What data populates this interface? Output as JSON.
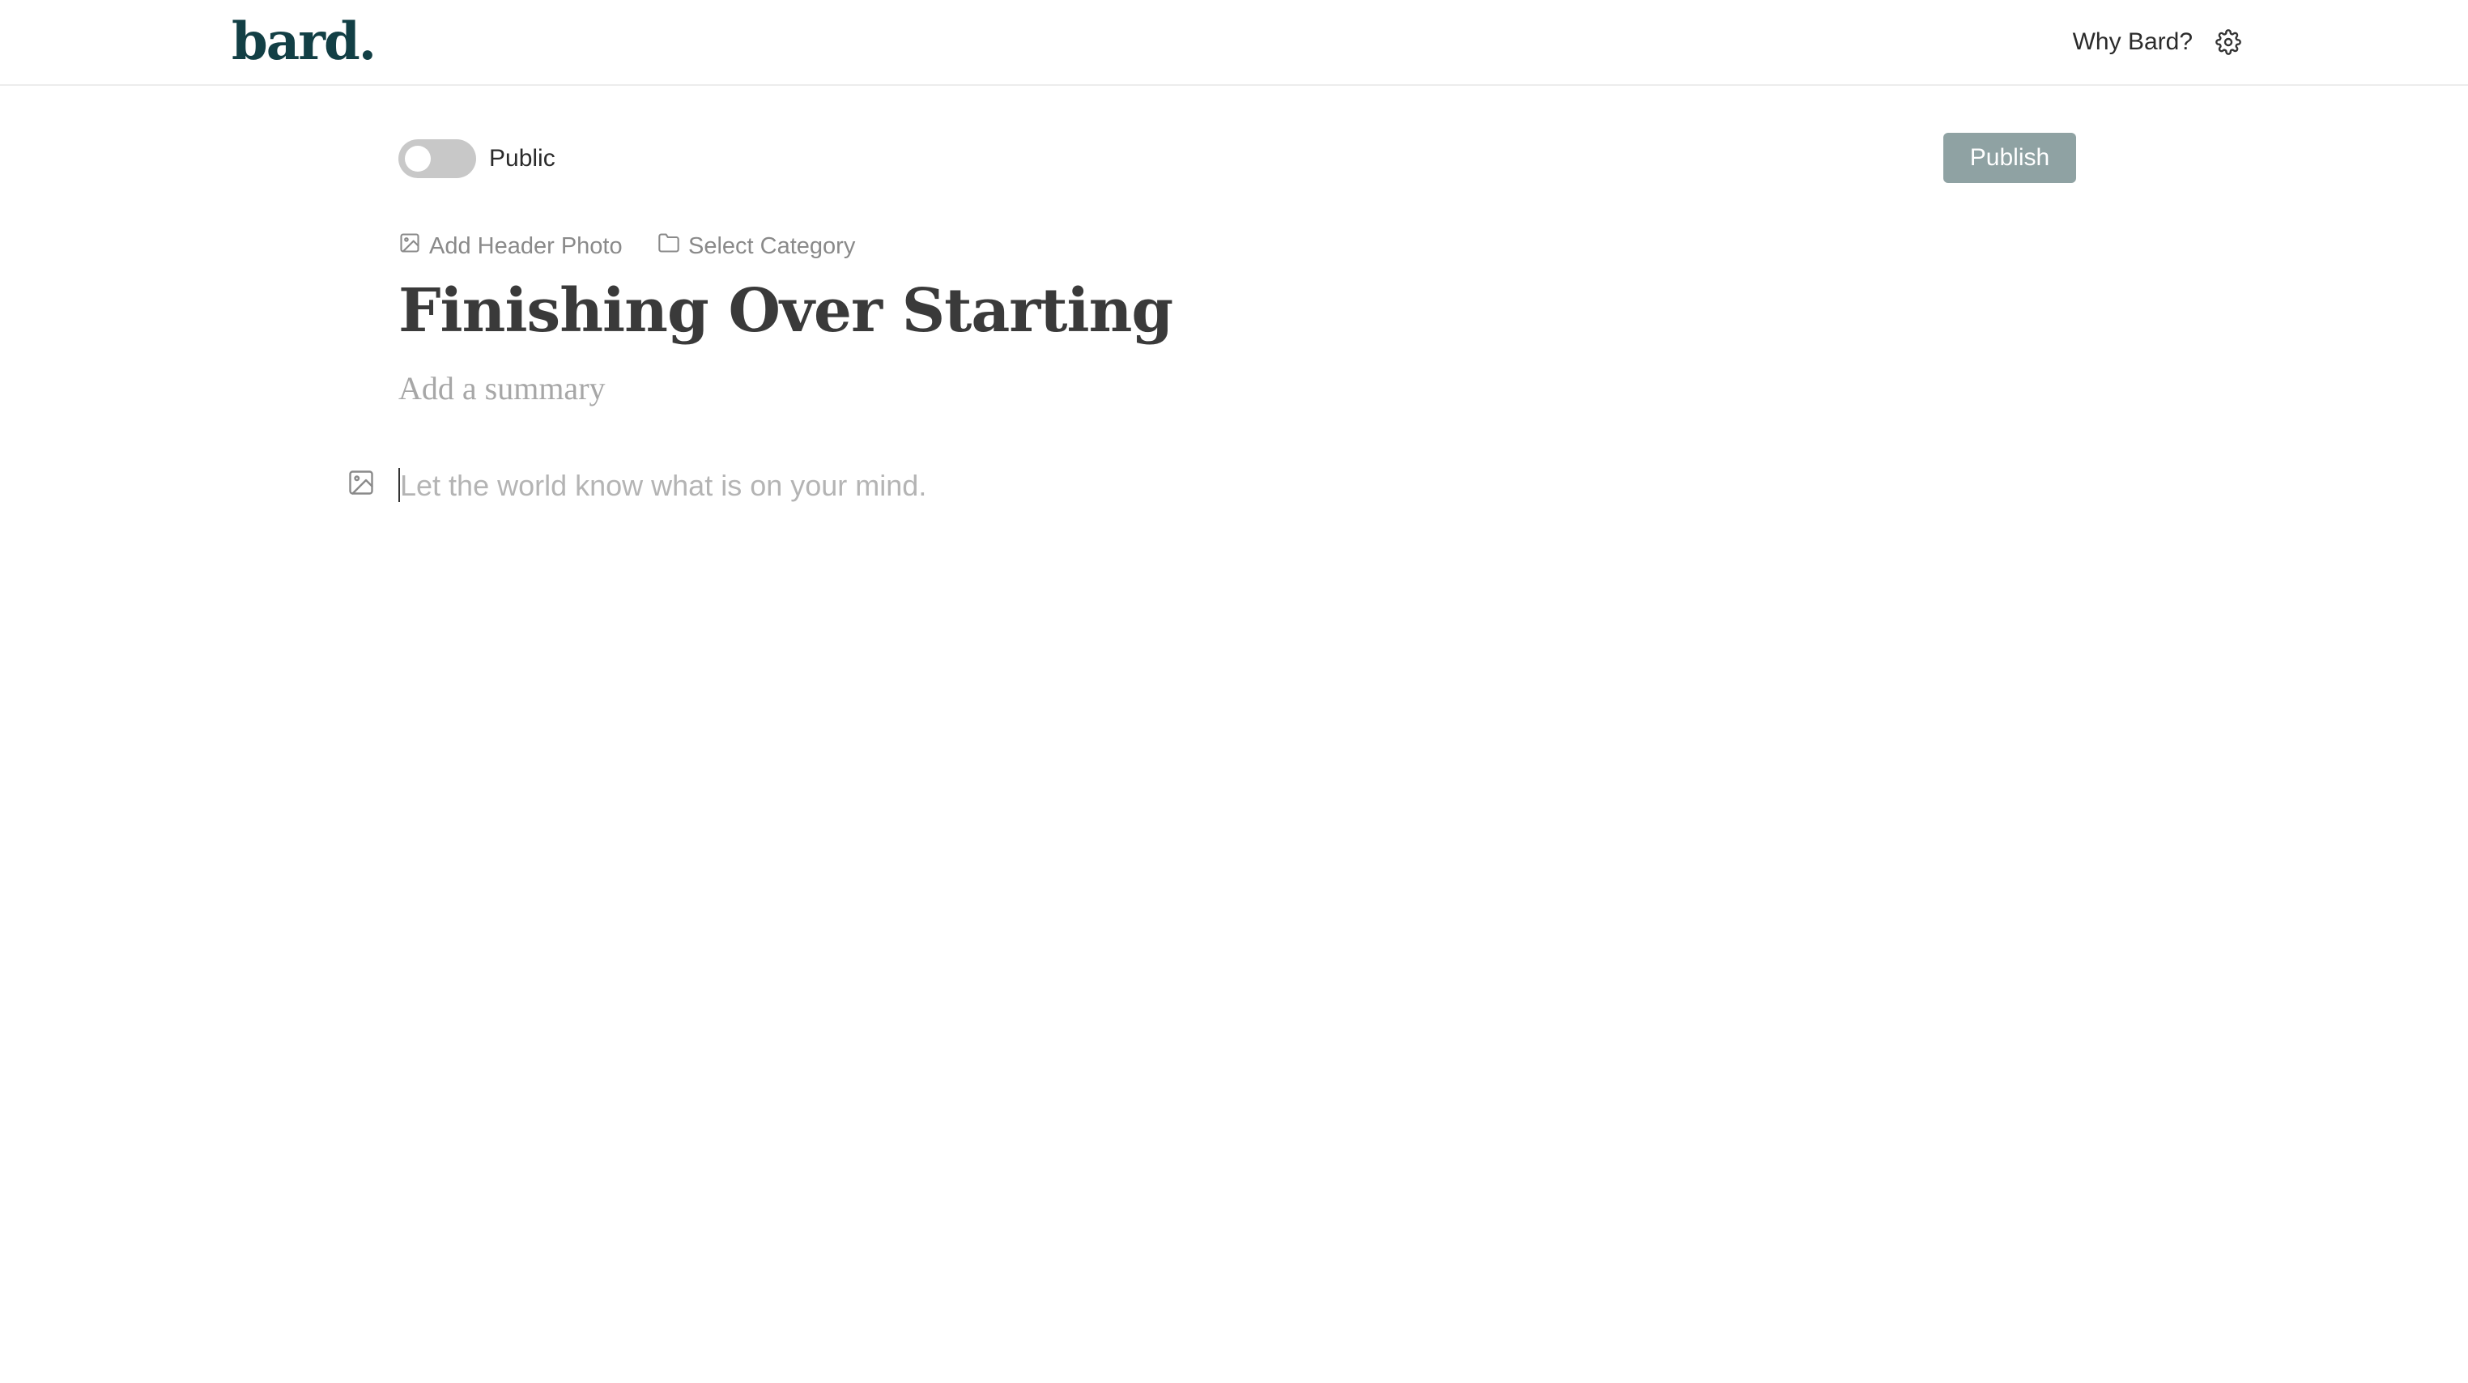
{
  "header": {
    "logo_text": "bard.",
    "why_link_label": "Why Bard?",
    "settings_icon": "gear-icon"
  },
  "toolbar": {
    "visibility_toggle": {
      "label": "Public",
      "on": false
    },
    "publish_label": "Publish"
  },
  "meta": {
    "add_header_photo_label": "Add Header Photo",
    "add_header_photo_icon": "image-icon",
    "select_category_label": "Select Category",
    "select_category_icon": "folder-icon"
  },
  "post": {
    "title": "Finishing Over Starting",
    "summary_placeholder": "Add a summary",
    "body_placeholder": "Let the world know what is on your mind.",
    "insert_image_icon": "image-icon"
  },
  "colors": {
    "brand": "#123f45",
    "publish_button": "#8fa2a3",
    "toggle_off": "#c8c8c8",
    "muted_text": "#8a8a8a",
    "placeholder_text": "#b4b4b4"
  }
}
